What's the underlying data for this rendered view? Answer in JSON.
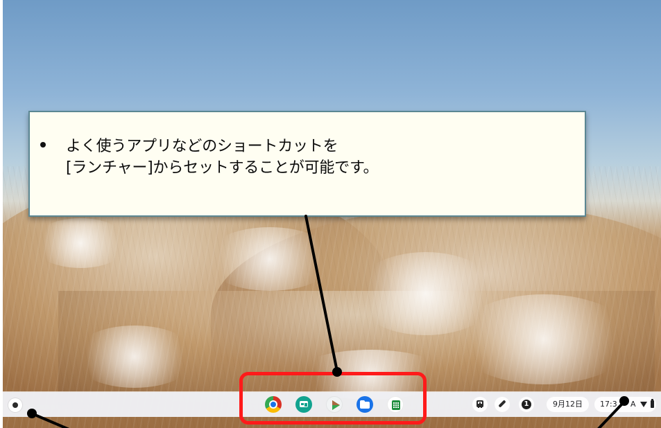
{
  "callout": {
    "bullet": "•",
    "line1": "よく使うアプリなどのショートカットを",
    "line2": "[ランチャー]からセットすることが可能です。"
  },
  "shelf": {
    "launcher_icon": "launcher-icon",
    "apps": [
      {
        "name": "chrome-app",
        "icon": "chrome-icon"
      },
      {
        "name": "card-app",
        "icon": "card-icon"
      },
      {
        "name": "play-store-app",
        "icon": "play-store-icon"
      },
      {
        "name": "files-app",
        "icon": "folder-icon"
      },
      {
        "name": "sheet-app",
        "icon": "sheet-icon"
      }
    ]
  },
  "tray": {
    "holding_space_icon": "holding-space-icon",
    "pen_icon": "pen-icon",
    "notification_count": "1",
    "date": "9月12日",
    "time": "17:3",
    "ime_label": "A",
    "wifi_icon": "wifi-icon",
    "battery_icon": "battery-icon"
  },
  "colors": {
    "highlight": "#ff1a1a",
    "callout_border": "#5b8793",
    "callout_bg": "#fffef2"
  }
}
